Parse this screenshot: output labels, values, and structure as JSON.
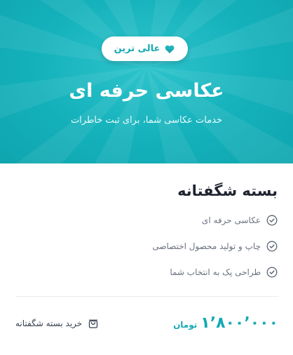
{
  "hero": {
    "badge_label": "عالی ترین",
    "badge_icon": "heart-icon",
    "title": "عکاسی حرفه ای",
    "subtitle": "خدمات عکاسی شما، برای ثبت خاطرات"
  },
  "package": {
    "title": "بسته شگفتانه",
    "features": [
      {
        "label": "عکاسی حرفه ای",
        "icon": "check-circle-icon"
      },
      {
        "label": "چاپ و تولید محصول اختصاصی",
        "icon": "check-circle-icon"
      },
      {
        "label": "طراحی پک به انتخاب شما",
        "icon": "check-circle-icon"
      }
    ],
    "price": "۱٬۸۰۰٬۰۰۰",
    "currency": "تومان",
    "buy_label": "خرید بسته شگفتانه",
    "buy_icon": "shopping-bag-icon"
  },
  "colors": {
    "accent": "#14b1bb",
    "title_text": "#1f2430",
    "muted_text": "#6b7280"
  }
}
